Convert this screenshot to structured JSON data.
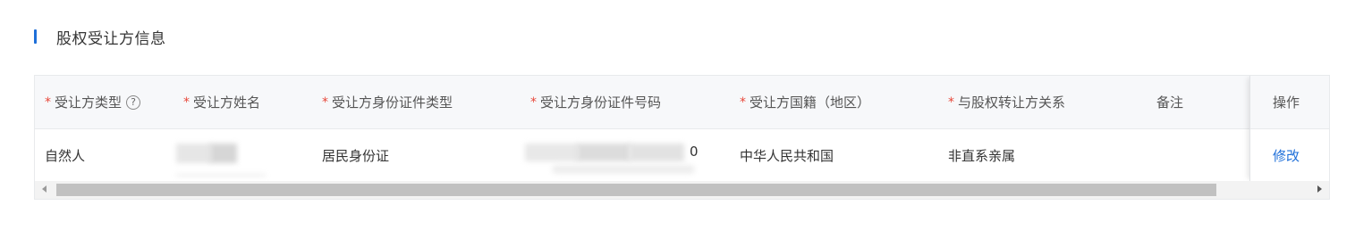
{
  "section": {
    "title": "股权受让方信息"
  },
  "table": {
    "columns": [
      {
        "label": "受让方类型",
        "required": true,
        "help": true
      },
      {
        "label": "受让方姓名",
        "required": true
      },
      {
        "label": "受让方身份证件类型",
        "required": true
      },
      {
        "label": "受让方身份证件号码",
        "required": true
      },
      {
        "label": "受让方国籍（地区）",
        "required": true
      },
      {
        "label": "与股权转让方关系",
        "required": true
      },
      {
        "label": "备注",
        "required": false
      },
      {
        "label": "操作",
        "required": false
      }
    ],
    "required_mark": "*",
    "help_mark": "?",
    "rows": [
      {
        "type": "自然人",
        "name": "",
        "id_type": "居民身份证",
        "id_number_suffix": "0",
        "nationality": "中华人民共和国",
        "relation": "非直系亲属",
        "remark": "",
        "action": "修改"
      }
    ]
  },
  "colors": {
    "accent": "#1e6fd9",
    "required": "#e8483b",
    "header_bg": "#f7f8fa"
  }
}
